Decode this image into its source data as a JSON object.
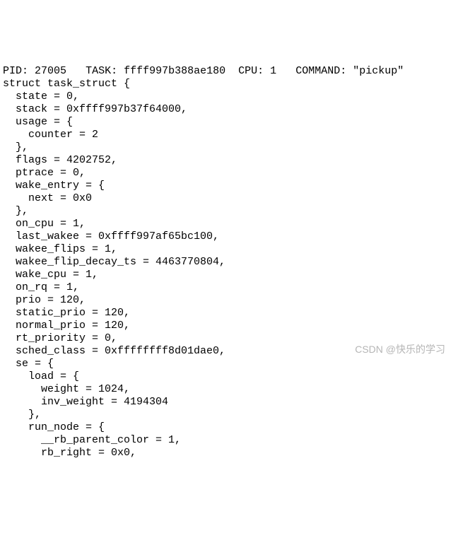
{
  "header": {
    "pid_label": "PID:",
    "pid_value": "27005",
    "task_label": "TASK:",
    "task_value": "ffff997b388ae180",
    "cpu_label": "CPU:",
    "cpu_value": "1",
    "command_label": "COMMAND:",
    "command_value": "\"pickup\""
  },
  "struct_decl": "struct task_struct {",
  "fields": {
    "state": "  state = 0,",
    "stack": "  stack = 0xffff997b37f64000,",
    "usage_open": "  usage = {",
    "usage_counter": "    counter = 2",
    "usage_close": "  },",
    "flags": "  flags = 4202752,",
    "ptrace": "  ptrace = 0,",
    "wake_entry_open": "  wake_entry = {",
    "wake_entry_next": "    next = 0x0",
    "wake_entry_close": "  },",
    "on_cpu": "  on_cpu = 1,",
    "last_wakee": "  last_wakee = 0xffff997af65bc100,",
    "wakee_flips": "  wakee_flips = 1,",
    "wakee_flip_decay_ts": "  wakee_flip_decay_ts = 4463770804,",
    "wake_cpu": "  wake_cpu = 1,",
    "on_rq": "  on_rq = 1,",
    "prio": "  prio = 120,",
    "static_prio": "  static_prio = 120,",
    "normal_prio": "  normal_prio = 120,",
    "rt_priority": "  rt_priority = 0,",
    "sched_class": "  sched_class = 0xffffffff8d01dae0,",
    "se_open": "  se = {",
    "load_open": "    load = {",
    "load_weight": "      weight = 1024,",
    "load_inv_weight": "      inv_weight = 4194304",
    "load_close": "    },",
    "run_node_open": "    run_node = {",
    "rb_parent_color": "      __rb_parent_color = 1,",
    "rb_right": "      rb_right = 0x0,"
  },
  "watermark": "CSDN @快乐的学习"
}
